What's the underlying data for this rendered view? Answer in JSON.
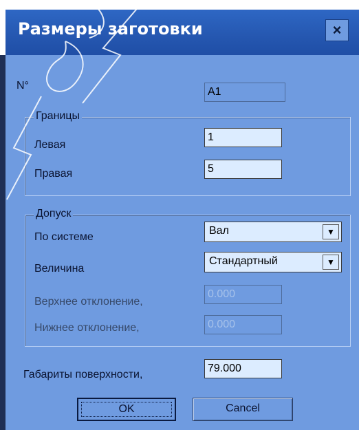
{
  "window": {
    "title": "Размеры заготовки",
    "close_glyph": "×"
  },
  "number_row": {
    "label": "N°",
    "value": "A1"
  },
  "bounds": {
    "legend": "Границы",
    "left_label": "Левая",
    "left_value": "1",
    "right_label": "Правая",
    "right_value": "5"
  },
  "tolerance": {
    "legend": "Допуск",
    "system_label": "По системе",
    "system_value": "Вал",
    "magnitude_label": "Величина",
    "magnitude_value": "Стандартный",
    "upper_label": "Верхнее отклонение,",
    "upper_value": "0.000",
    "lower_label": "Нижнее отклонение,",
    "lower_value": "0.000"
  },
  "surface": {
    "label": "Габариты поверхности,",
    "value": "79.000"
  },
  "buttons": {
    "ok": "OK",
    "cancel": "Cancel"
  },
  "icons": {
    "close": "close-icon",
    "dropdown": "chevron-down-icon"
  },
  "colors": {
    "dialog_bg": "#6f9be0",
    "titlebar": "#2557b0",
    "field_bg": "#dcecff"
  }
}
